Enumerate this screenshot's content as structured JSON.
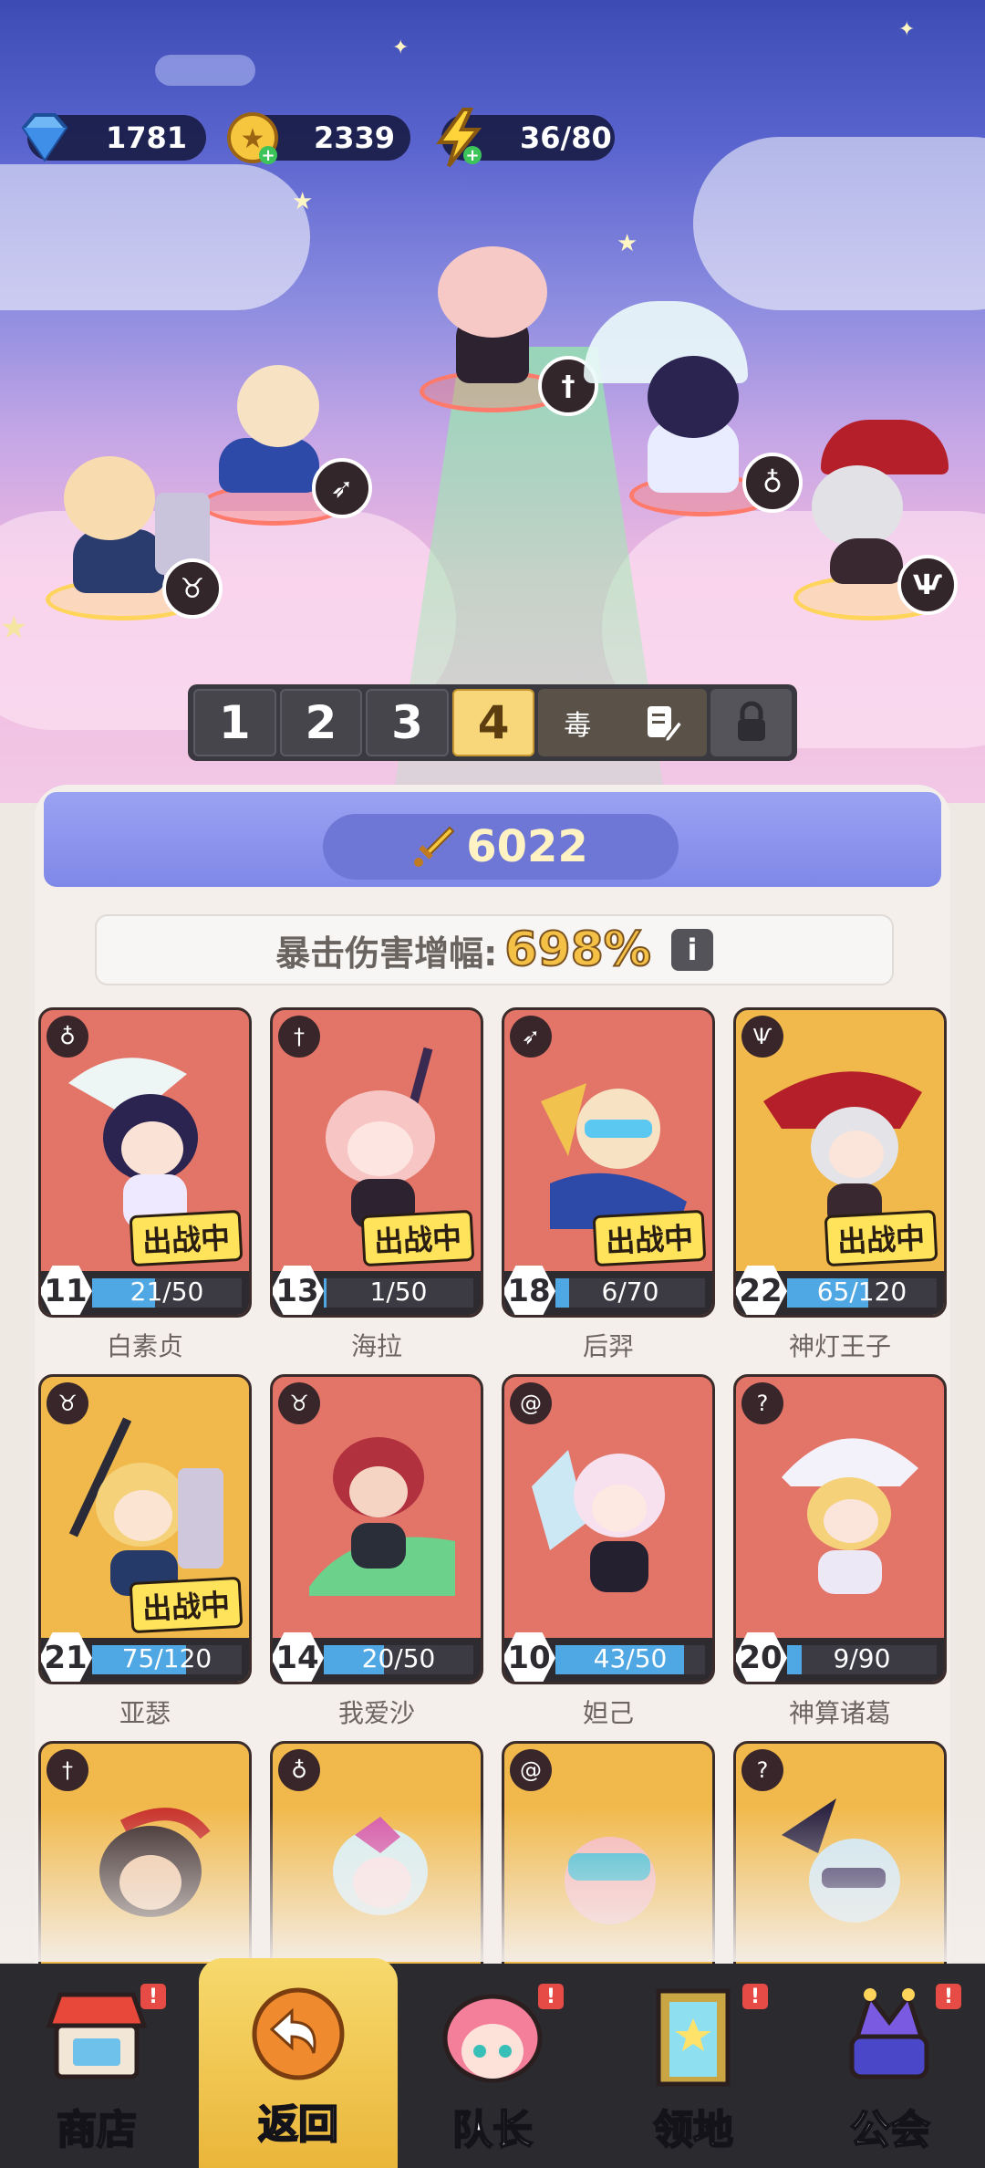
{
  "currencies": {
    "gems": "1781",
    "coins": "2339",
    "energy": "36/80"
  },
  "lineup_tabs": {
    "tab1": "1",
    "tab2": "2",
    "tab3": "3",
    "tab4": "4",
    "name": "毒"
  },
  "power": "6022",
  "crit": {
    "label": "暴击伤害增幅:",
    "value": "698%"
  },
  "deployed_label": "出战中",
  "cards": [
    {
      "name": "白素贞",
      "level": "11",
      "progress": "21/50",
      "fraction": 0.42,
      "deployed": true
    },
    {
      "name": "海拉",
      "level": "13",
      "progress": "1/50",
      "fraction": 0.02,
      "deployed": true
    },
    {
      "name": "后羿",
      "level": "18",
      "progress": "6/70",
      "fraction": 0.09,
      "deployed": true
    },
    {
      "name": "神灯王子",
      "level": "22",
      "progress": "65/120",
      "fraction": 0.54,
      "deployed": true
    },
    {
      "name": "亚瑟",
      "level": "21",
      "progress": "75/120",
      "fraction": 0.63,
      "deployed": true
    },
    {
      "name": "我爱沙",
      "level": "14",
      "progress": "20/50",
      "fraction": 0.4,
      "deployed": false
    },
    {
      "name": "妲己",
      "level": "10",
      "progress": "43/50",
      "fraction": 0.86,
      "deployed": false
    },
    {
      "name": "神算诸葛",
      "level": "20",
      "progress": "9/90",
      "fraction": 0.1,
      "deployed": false
    }
  ],
  "nav": {
    "shop": "商店",
    "back": "返回",
    "captain": "队长",
    "territory": "领地",
    "guild": "公会"
  },
  "badge": "!"
}
